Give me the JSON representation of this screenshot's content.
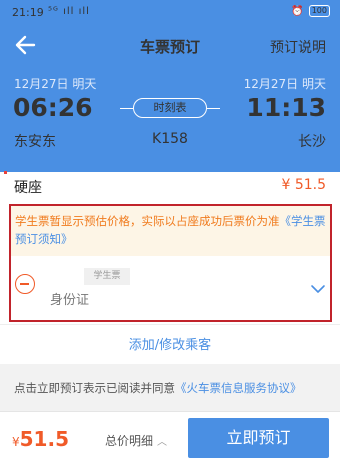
{
  "status_bar": {
    "time": "21:19",
    "signal": "⁵ᴳ ıll ıll",
    "alarm": "⏰",
    "battery": "100"
  },
  "navbar": {
    "back_icon": "back-arrow-icon",
    "title": "车票预订",
    "help_label": "预订说明"
  },
  "journey": {
    "departure_date": "12月27日 明天",
    "arrival_date": "12月27日 明天",
    "departure_time": "06:26",
    "arrival_time": "11:13",
    "schedule_label": "时刻表",
    "from_station": "东安东",
    "to_station": "长沙",
    "train_number": "K158"
  },
  "seat": {
    "type": "硬座",
    "price": "¥ 51.5"
  },
  "passenger": {
    "notice_text": "学生票暂显示预估价格，实际以占座成功后票价为准",
    "notice_link": "《学生票预订须知》",
    "ticket_tag": "学生票",
    "id_label": "身份证",
    "remove_icon": "minus-circle-icon",
    "expand_icon": "chevron-down-icon"
  },
  "add_passenger_label": "添加/修改乘客",
  "agreement": {
    "text": "点击立即预订表示已阅读并同意",
    "link": "《火车票信息服务协议》"
  },
  "footer": {
    "currency": "¥",
    "total": "51.5",
    "detail_label": "总价明细",
    "book_label": "立即预订"
  },
  "colors": {
    "primary": "#4a8fe3",
    "price": "#f05a28",
    "highlight_border": "#c1232b"
  }
}
